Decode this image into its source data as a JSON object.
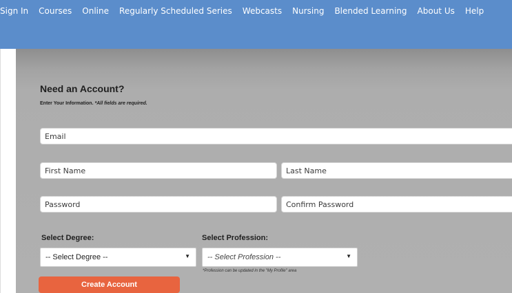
{
  "nav": {
    "items": [
      {
        "label": "Sign In"
      },
      {
        "label": "Courses"
      },
      {
        "label": "Online"
      },
      {
        "label": "Regularly Scheduled Series"
      },
      {
        "label": "Webcasts"
      },
      {
        "label": "Nursing"
      },
      {
        "label": "Blended Learning"
      },
      {
        "label": "About Us"
      },
      {
        "label": "Help"
      }
    ]
  },
  "form": {
    "title": "Need an Account?",
    "subtitle": "Enter Your Information.",
    "required_note": "*All fields are required.",
    "email_placeholder": "Email",
    "first_name_placeholder": "First Name",
    "last_name_placeholder": "Last Name",
    "password_placeholder": "Password",
    "confirm_password_placeholder": "Confirm Password",
    "degree_label": "Select Degree:",
    "degree_selected": "-- Select Degree --",
    "profession_label": "Select Profession:",
    "profession_selected": "-- Select Profession --",
    "profession_note": "*Profession can be updated in the \"My Profile\" area",
    "submit_label": "Create Account"
  },
  "colors": {
    "header": "#5b8dcb",
    "panel": "#adadad",
    "submit": "#e8643f"
  }
}
